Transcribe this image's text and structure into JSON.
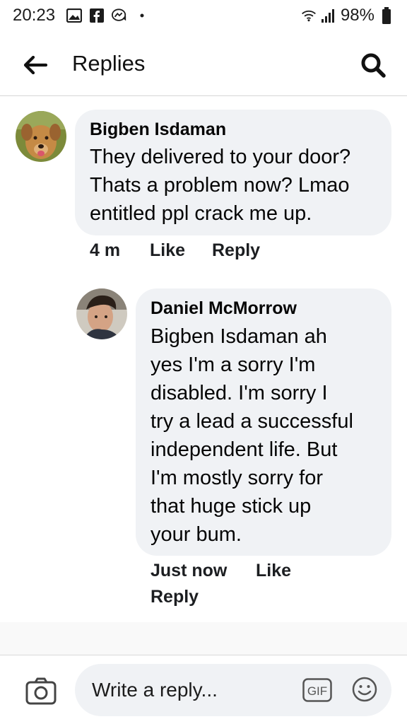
{
  "status_bar": {
    "time": "20:23",
    "battery": "98%",
    "icons": [
      "gallery-icon",
      "facebook-icon",
      "messenger-icon",
      "dot-icon",
      "wifi-icon",
      "signal-icon",
      "battery-icon"
    ]
  },
  "header": {
    "title": "Replies",
    "back_icon": "back-arrow-icon",
    "search_icon": "search-icon"
  },
  "comments": [
    {
      "author": "Bigben Isdaman",
      "lines": [
        "They delivered to your door?",
        "Thats a problem now? Lmao",
        "entitled ppl crack me up."
      ],
      "time": "4 m",
      "like_label": "Like",
      "reply_label": "Reply"
    },
    {
      "author": "Daniel McMorrow",
      "lines": [
        "Bigben Isdaman ah",
        "yes I'm a sorry I'm",
        "disabled. I'm sorry I",
        "try a lead a successful",
        "independent life. But",
        "I'm mostly sorry for",
        "that huge stick up",
        "your bum."
      ],
      "time": "Just now",
      "like_label": "Like",
      "reply_label": "Reply"
    }
  ],
  "composer": {
    "placeholder": "Write a reply...",
    "camera_icon": "camera-icon",
    "gif_label": "GIF",
    "emoji_icon": "emoji-icon"
  },
  "colors": {
    "bubble": "#f0f2f5",
    "text": "#050505",
    "divider": "#d6d6d6"
  }
}
